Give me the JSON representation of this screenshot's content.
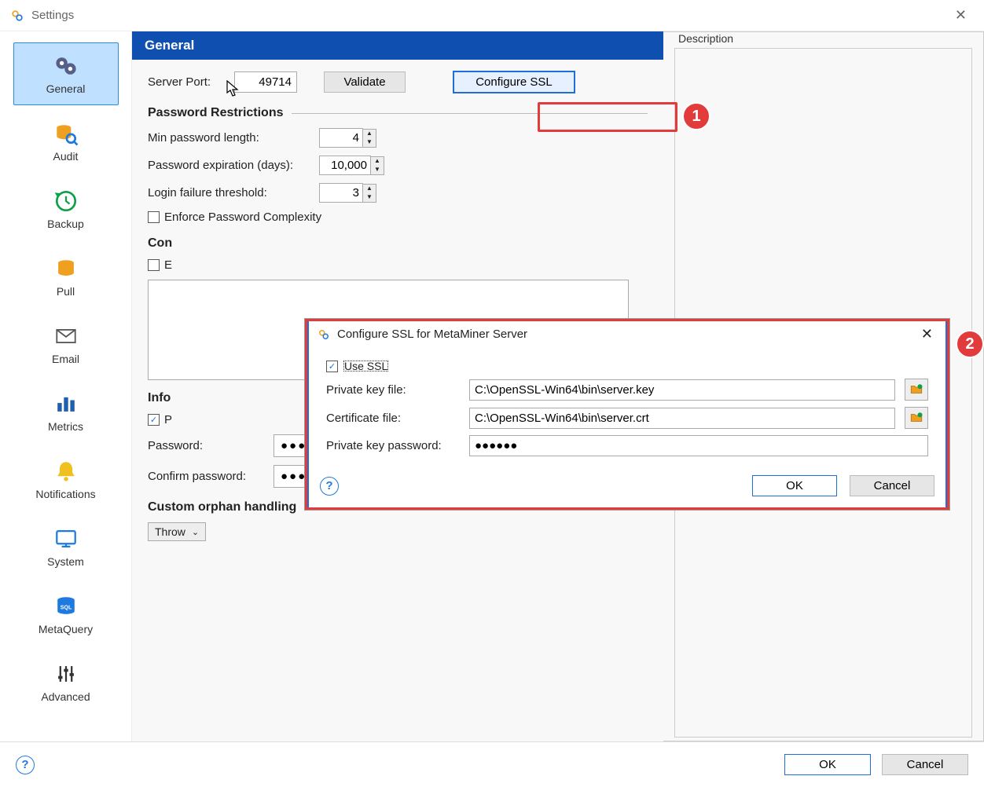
{
  "window": {
    "title": "Settings"
  },
  "sidebar": {
    "items": [
      {
        "label": "General"
      },
      {
        "label": "Audit"
      },
      {
        "label": "Backup"
      },
      {
        "label": "Pull"
      },
      {
        "label": "Email"
      },
      {
        "label": "Metrics"
      },
      {
        "label": "Notifications"
      },
      {
        "label": "System"
      },
      {
        "label": "MetaQuery"
      },
      {
        "label": "Advanced"
      }
    ]
  },
  "panel": {
    "header": "General",
    "server_port_label": "Server Port:",
    "server_port_value": "49714",
    "validate_label": "Validate",
    "configure_ssl_label": "Configure SSL",
    "pw_restrictions_title": "Password Restrictions",
    "min_pw_label": "Min password length:",
    "min_pw_value": "4",
    "pw_exp_label": "Password expiration (days):",
    "pw_exp_value": "10,000",
    "login_fail_label": "Login failure threshold:",
    "login_fail_value": "3",
    "enforce_pw_complexity_label": "Enforce Password Complexity",
    "con_title": "Con",
    "con_checkbox_partial": "E",
    "info_title": "Info",
    "info_checkbox_partial": "P",
    "password_label": "Password:",
    "password_value": "●●●●●●●●●●",
    "confirm_password_label": "Confirm password:",
    "confirm_password_value": "●●●●●●●●●●",
    "orphan_title": "Custom orphan handling",
    "orphan_value": "Throw"
  },
  "description": {
    "legend": "Description"
  },
  "modal": {
    "title": "Configure SSL for MetaMiner Server",
    "use_ssl_label": "Use SSL",
    "use_ssl_checked": true,
    "pk_file_label": "Private key file:",
    "pk_file_value": "C:\\OpenSSL-Win64\\bin\\server.key",
    "cert_file_label": "Certificate file:",
    "cert_file_value": "C:\\OpenSSL-Win64\\bin\\server.crt",
    "pk_pw_label": "Private key password:",
    "pk_pw_value": "●●●●●●",
    "ok_label": "OK",
    "cancel_label": "Cancel"
  },
  "buttons": {
    "ok": "OK",
    "cancel": "Cancel"
  },
  "callouts": {
    "one": "1",
    "two": "2"
  }
}
